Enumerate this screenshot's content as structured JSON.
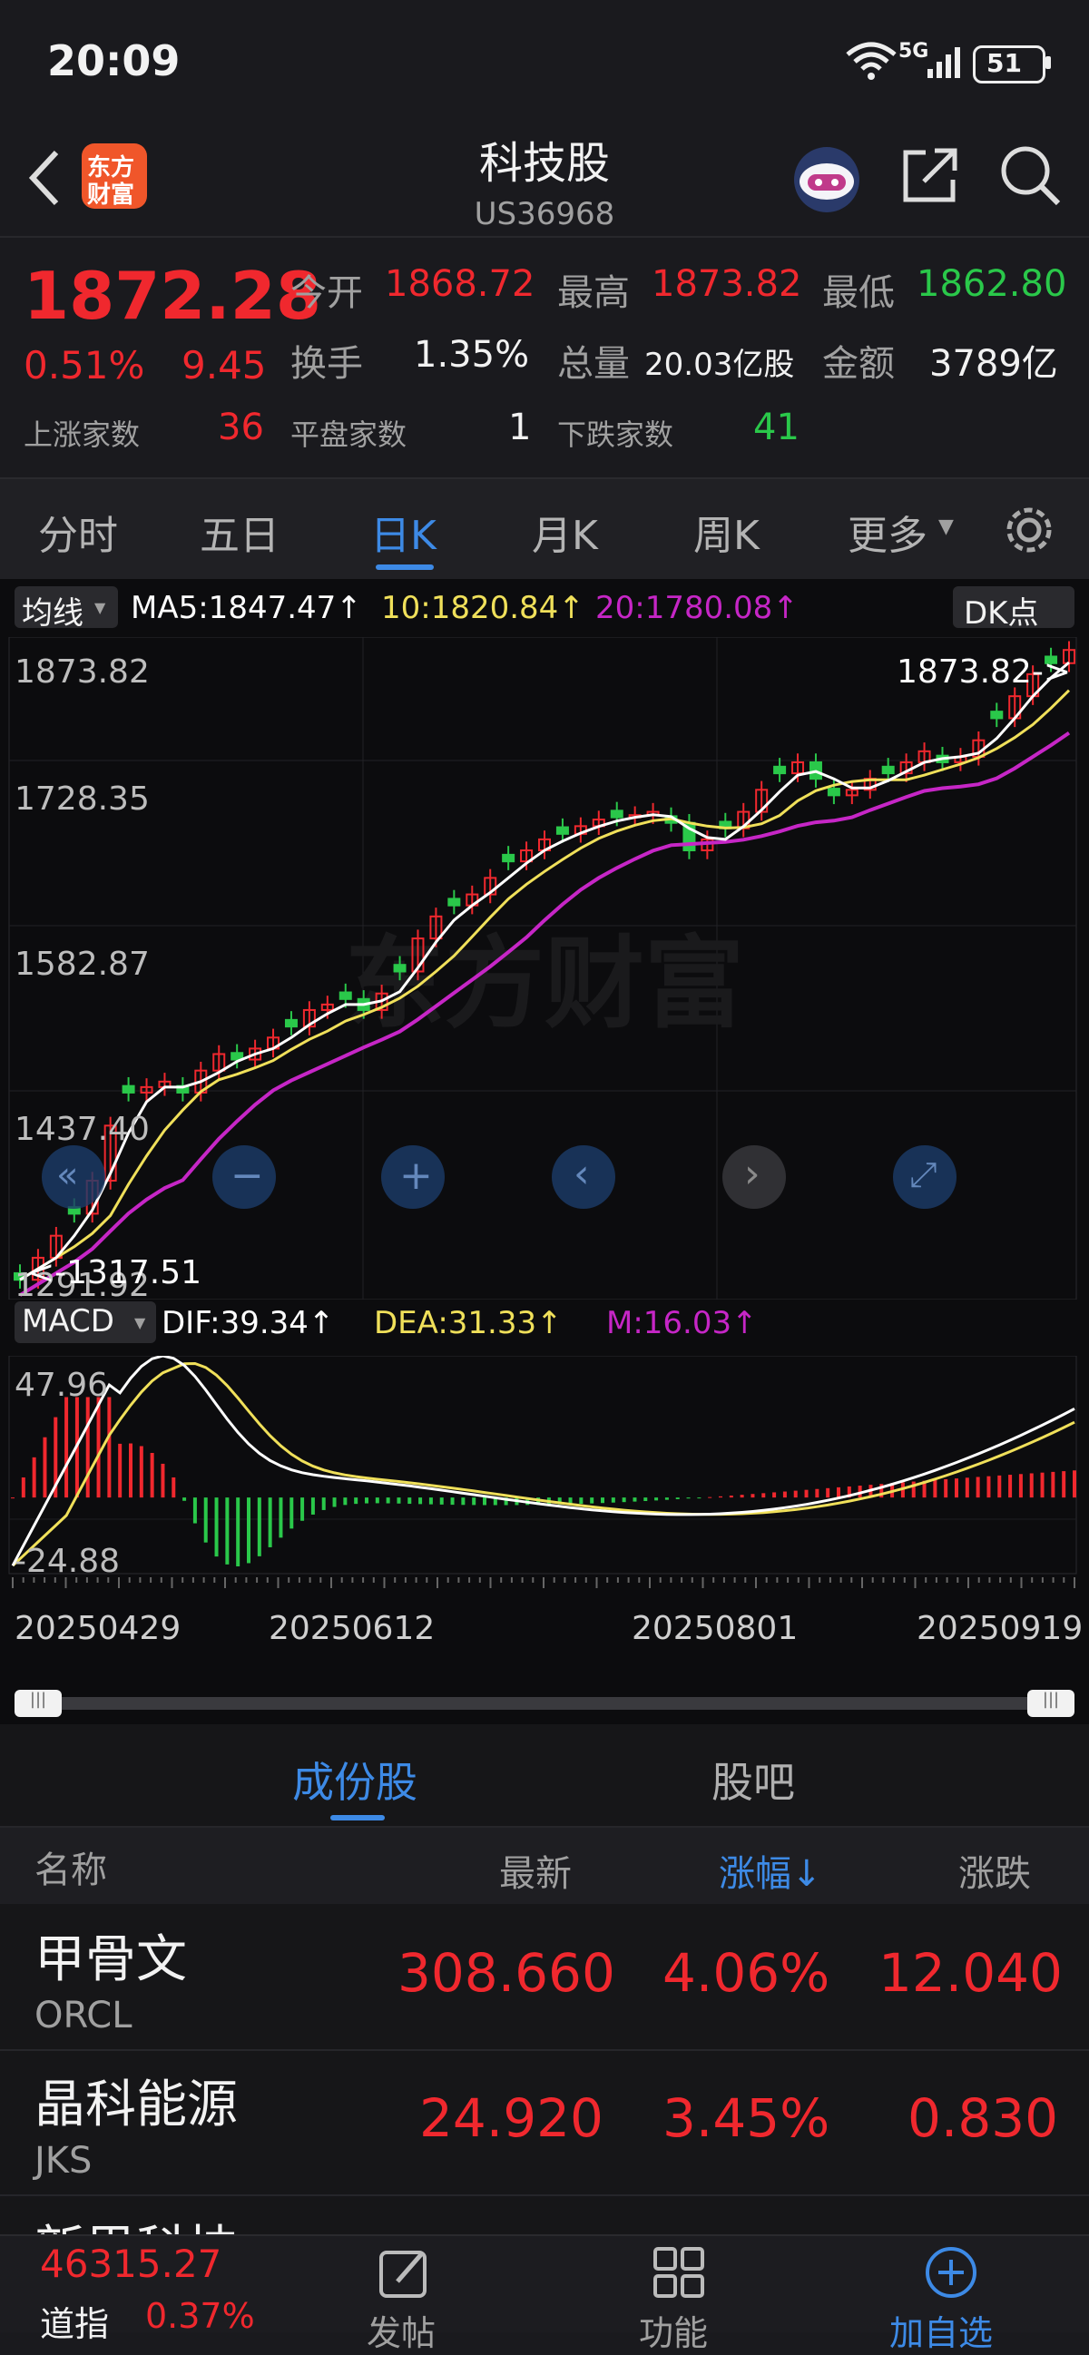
{
  "status": {
    "time": "20:09",
    "battery": "51",
    "network": "5G"
  },
  "header": {
    "title": "科技股",
    "code": "US36968",
    "logo_line1": "东方",
    "logo_line2": "财富"
  },
  "quote": {
    "price": "1872.28",
    "pct": "0.51%",
    "change": "9.45",
    "open_label": "今开",
    "open": "1868.72",
    "high_label": "最高",
    "high": "1873.82",
    "low_label": "最低",
    "low": "1862.80",
    "turnover_label": "换手",
    "turnover": "1.35%",
    "volume_label": "总量",
    "volume": "20.03亿股",
    "amount_label": "金额",
    "amount": "3789亿",
    "up_label": "上涨家数",
    "up": "36",
    "flat_label": "平盘家数",
    "flat": "1",
    "down_label": "下跌家数",
    "down": "41"
  },
  "tabs": [
    "分时",
    "五日",
    "日K",
    "月K",
    "周K",
    "更多"
  ],
  "active_tab": "日K",
  "ma": {
    "selector": "均线",
    "ma5": "MA5:1847.47↑",
    "ma10": "10:1820.84↑",
    "ma20": "20:1780.08↑",
    "dk": "DK点"
  },
  "price_axis": [
    "1873.82",
    "1728.35",
    "1582.87",
    "1437.40",
    "1291.92"
  ],
  "high_marker": "1873.82->",
  "low_marker": "<-1317.51",
  "macd": {
    "selector": "MACD",
    "dif": "DIF:39.34↑",
    "dea": "DEA:31.33↑",
    "m": "M:16.03↑",
    "top": "47.96",
    "bottom": "-24.88"
  },
  "dates": [
    "20250429",
    "20250612",
    "20250801",
    "20250919"
  ],
  "watermark": "东方财富",
  "chart_controls": [
    "«",
    "−",
    "+",
    "‹",
    "›",
    "⤢"
  ],
  "list_tabs": [
    "成份股",
    "股吧"
  ],
  "columns": {
    "name": "名称",
    "latest": "最新",
    "pct": "涨幅↓",
    "change": "涨跌"
  },
  "rows": [
    {
      "name": "甲骨文",
      "code": "ORCL",
      "latest": "308.660",
      "pct": "4.06%",
      "change": "12.040"
    },
    {
      "name": "晶科能源",
      "code": "JKS",
      "latest": "24.920",
      "pct": "3.45%",
      "change": "0.830"
    },
    {
      "name": "新思科技",
      "code": "",
      "latest": "",
      "pct": "",
      "change": ""
    }
  ],
  "bottom": {
    "index_value": "46315.27",
    "index_name": "道指",
    "index_pct": "0.37%",
    "nav": [
      "发帖",
      "功能",
      "加自选"
    ]
  },
  "colors": {
    "up": "#f0282e",
    "down": "#2ac84a",
    "ma5": "#ffffff",
    "ma10": "#f0e05a",
    "ma20": "#c626c6",
    "accent": "#3d8ae6"
  },
  "chart_data": {
    "type": "candlestick",
    "x_range": [
      "20250429",
      "20250919"
    ],
    "y_range": [
      1291.92,
      1873.82
    ],
    "close_trend": [
      1300,
      1320,
      1340,
      1360,
      1390,
      1440,
      1470,
      1475,
      1480,
      1470,
      1490,
      1505,
      1500,
      1510,
      1520,
      1530,
      1545,
      1550,
      1555,
      1545,
      1560,
      1580,
      1610,
      1630,
      1640,
      1650,
      1665,
      1680,
      1690,
      1700,
      1705,
      1712,
      1718,
      1720,
      1722,
      1725,
      1715,
      1690,
      1700,
      1710,
      1725,
      1745,
      1760,
      1770,
      1755,
      1740,
      1745,
      1755,
      1760,
      1770,
      1780,
      1770,
      1775,
      1790,
      1810,
      1830,
      1850,
      1860,
      1872
    ],
    "macd_range": [
      -24.88,
      47.96
    ]
  }
}
